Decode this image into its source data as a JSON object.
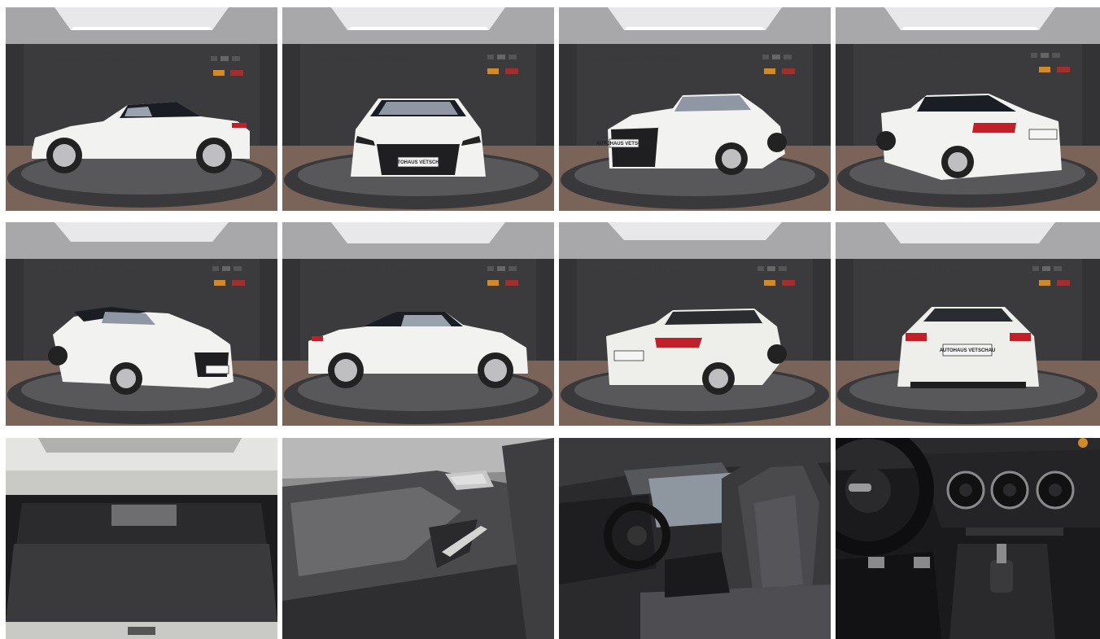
{
  "gallery": {
    "photos": [
      {
        "view": "side-left",
        "plate": "",
        "wall_logo": ""
      },
      {
        "view": "front",
        "plate": "AUTOHAUS VETSCHAU",
        "wall_logo": ""
      },
      {
        "view": "front-right",
        "plate": "AUTOHAUS VETSCHAU",
        "wall_logo": ""
      },
      {
        "view": "rear-left",
        "plate": "",
        "wall_logo": ""
      },
      {
        "view": "front-left",
        "plate": "",
        "wall_logo": ""
      },
      {
        "view": "side-right",
        "plate": "",
        "wall_logo": ""
      },
      {
        "view": "rear-right",
        "plate": "",
        "wall_logo": ""
      },
      {
        "view": "rear",
        "plate": "AUTOHAUS VETSCHAU",
        "wall_logo": ""
      },
      {
        "view": "trunk",
        "plate": "",
        "wall_logo": ""
      },
      {
        "view": "door-panel",
        "plate": "",
        "wall_logo": ""
      },
      {
        "view": "front-seats",
        "plate": "",
        "wall_logo": ""
      },
      {
        "view": "dashboard",
        "plate": "",
        "wall_logo": ""
      }
    ],
    "colors": {
      "ceiling": "#9a9a9c",
      "wall": "#3b3b3e",
      "floor": "#7a6358",
      "turntable": "#4a4a4c",
      "car_body": "#f2f2f0",
      "soft_top": "#1a1d24",
      "tail_light": "#c0202a",
      "interior": "#1e1e20"
    }
  }
}
